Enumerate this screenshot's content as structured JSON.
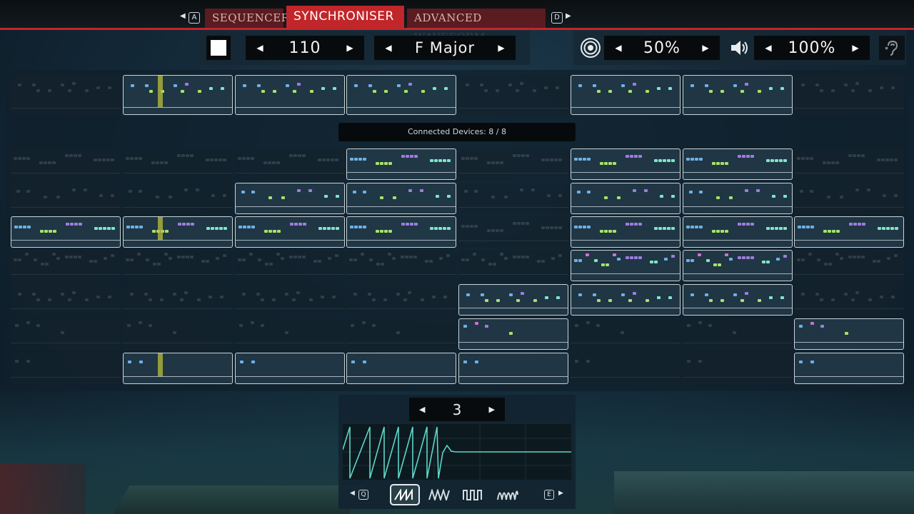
{
  "tabs": {
    "left_key": "A",
    "right_key": "D",
    "items": [
      {
        "label": "SEQUENCER",
        "active": false
      },
      {
        "label": "SYNCHRONISER",
        "active": true
      },
      {
        "label": "ADVANCED WAVEFORM",
        "active": false
      }
    ]
  },
  "controls": {
    "tempo": "110",
    "scale": "F Major",
    "reverb": "50%",
    "volume": "100%"
  },
  "status": {
    "connected_devices": "Connected Devices: 8 / 8"
  },
  "waveform": {
    "number": "3",
    "left_key": "Q",
    "right_key": "E",
    "buttons": [
      "sawtooth",
      "triangle",
      "square",
      "sine"
    ],
    "selected": 0
  },
  "colors": {
    "accent_red": "#c1262a",
    "note_blue": "#6fb0e6",
    "note_green": "#a8e26a",
    "note_teal": "#7fe6c6",
    "note_purple": "#a07ce0",
    "note_pink": "#d070d0",
    "playhead": "#b9be3c"
  },
  "grid": {
    "top_row": [
      "empty",
      "active",
      "active",
      "active",
      "empty",
      "active",
      "active",
      "empty"
    ],
    "rows": [
      [
        "empty",
        "empty",
        "empty",
        "active",
        "empty",
        "active",
        "active",
        "empty"
      ],
      [
        "empty",
        "empty",
        "active",
        "active",
        "empty",
        "active",
        "active",
        "empty"
      ],
      [
        "active",
        "active",
        "active",
        "active",
        "empty",
        "active",
        "active",
        "active"
      ],
      [
        "empty",
        "empty",
        "empty",
        "empty",
        "empty",
        "active",
        "active",
        "empty"
      ],
      [
        "empty",
        "empty",
        "empty",
        "empty",
        "active",
        "active",
        "active",
        "empty"
      ],
      [
        "empty",
        "empty",
        "empty",
        "empty",
        "active",
        "empty",
        "empty",
        "active"
      ],
      [
        "empty",
        "active",
        "active",
        "active",
        "active",
        "empty",
        "empty",
        "active"
      ]
    ]
  }
}
